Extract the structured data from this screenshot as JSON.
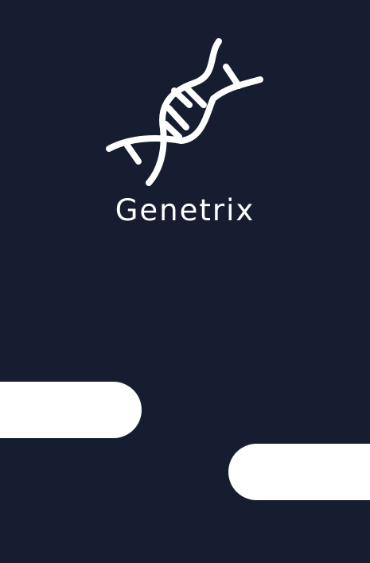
{
  "app": {
    "name": "Genetrix",
    "logo_icon": "dna-helix-icon"
  },
  "colors": {
    "background": "#161d31",
    "foreground": "#ffffff"
  }
}
